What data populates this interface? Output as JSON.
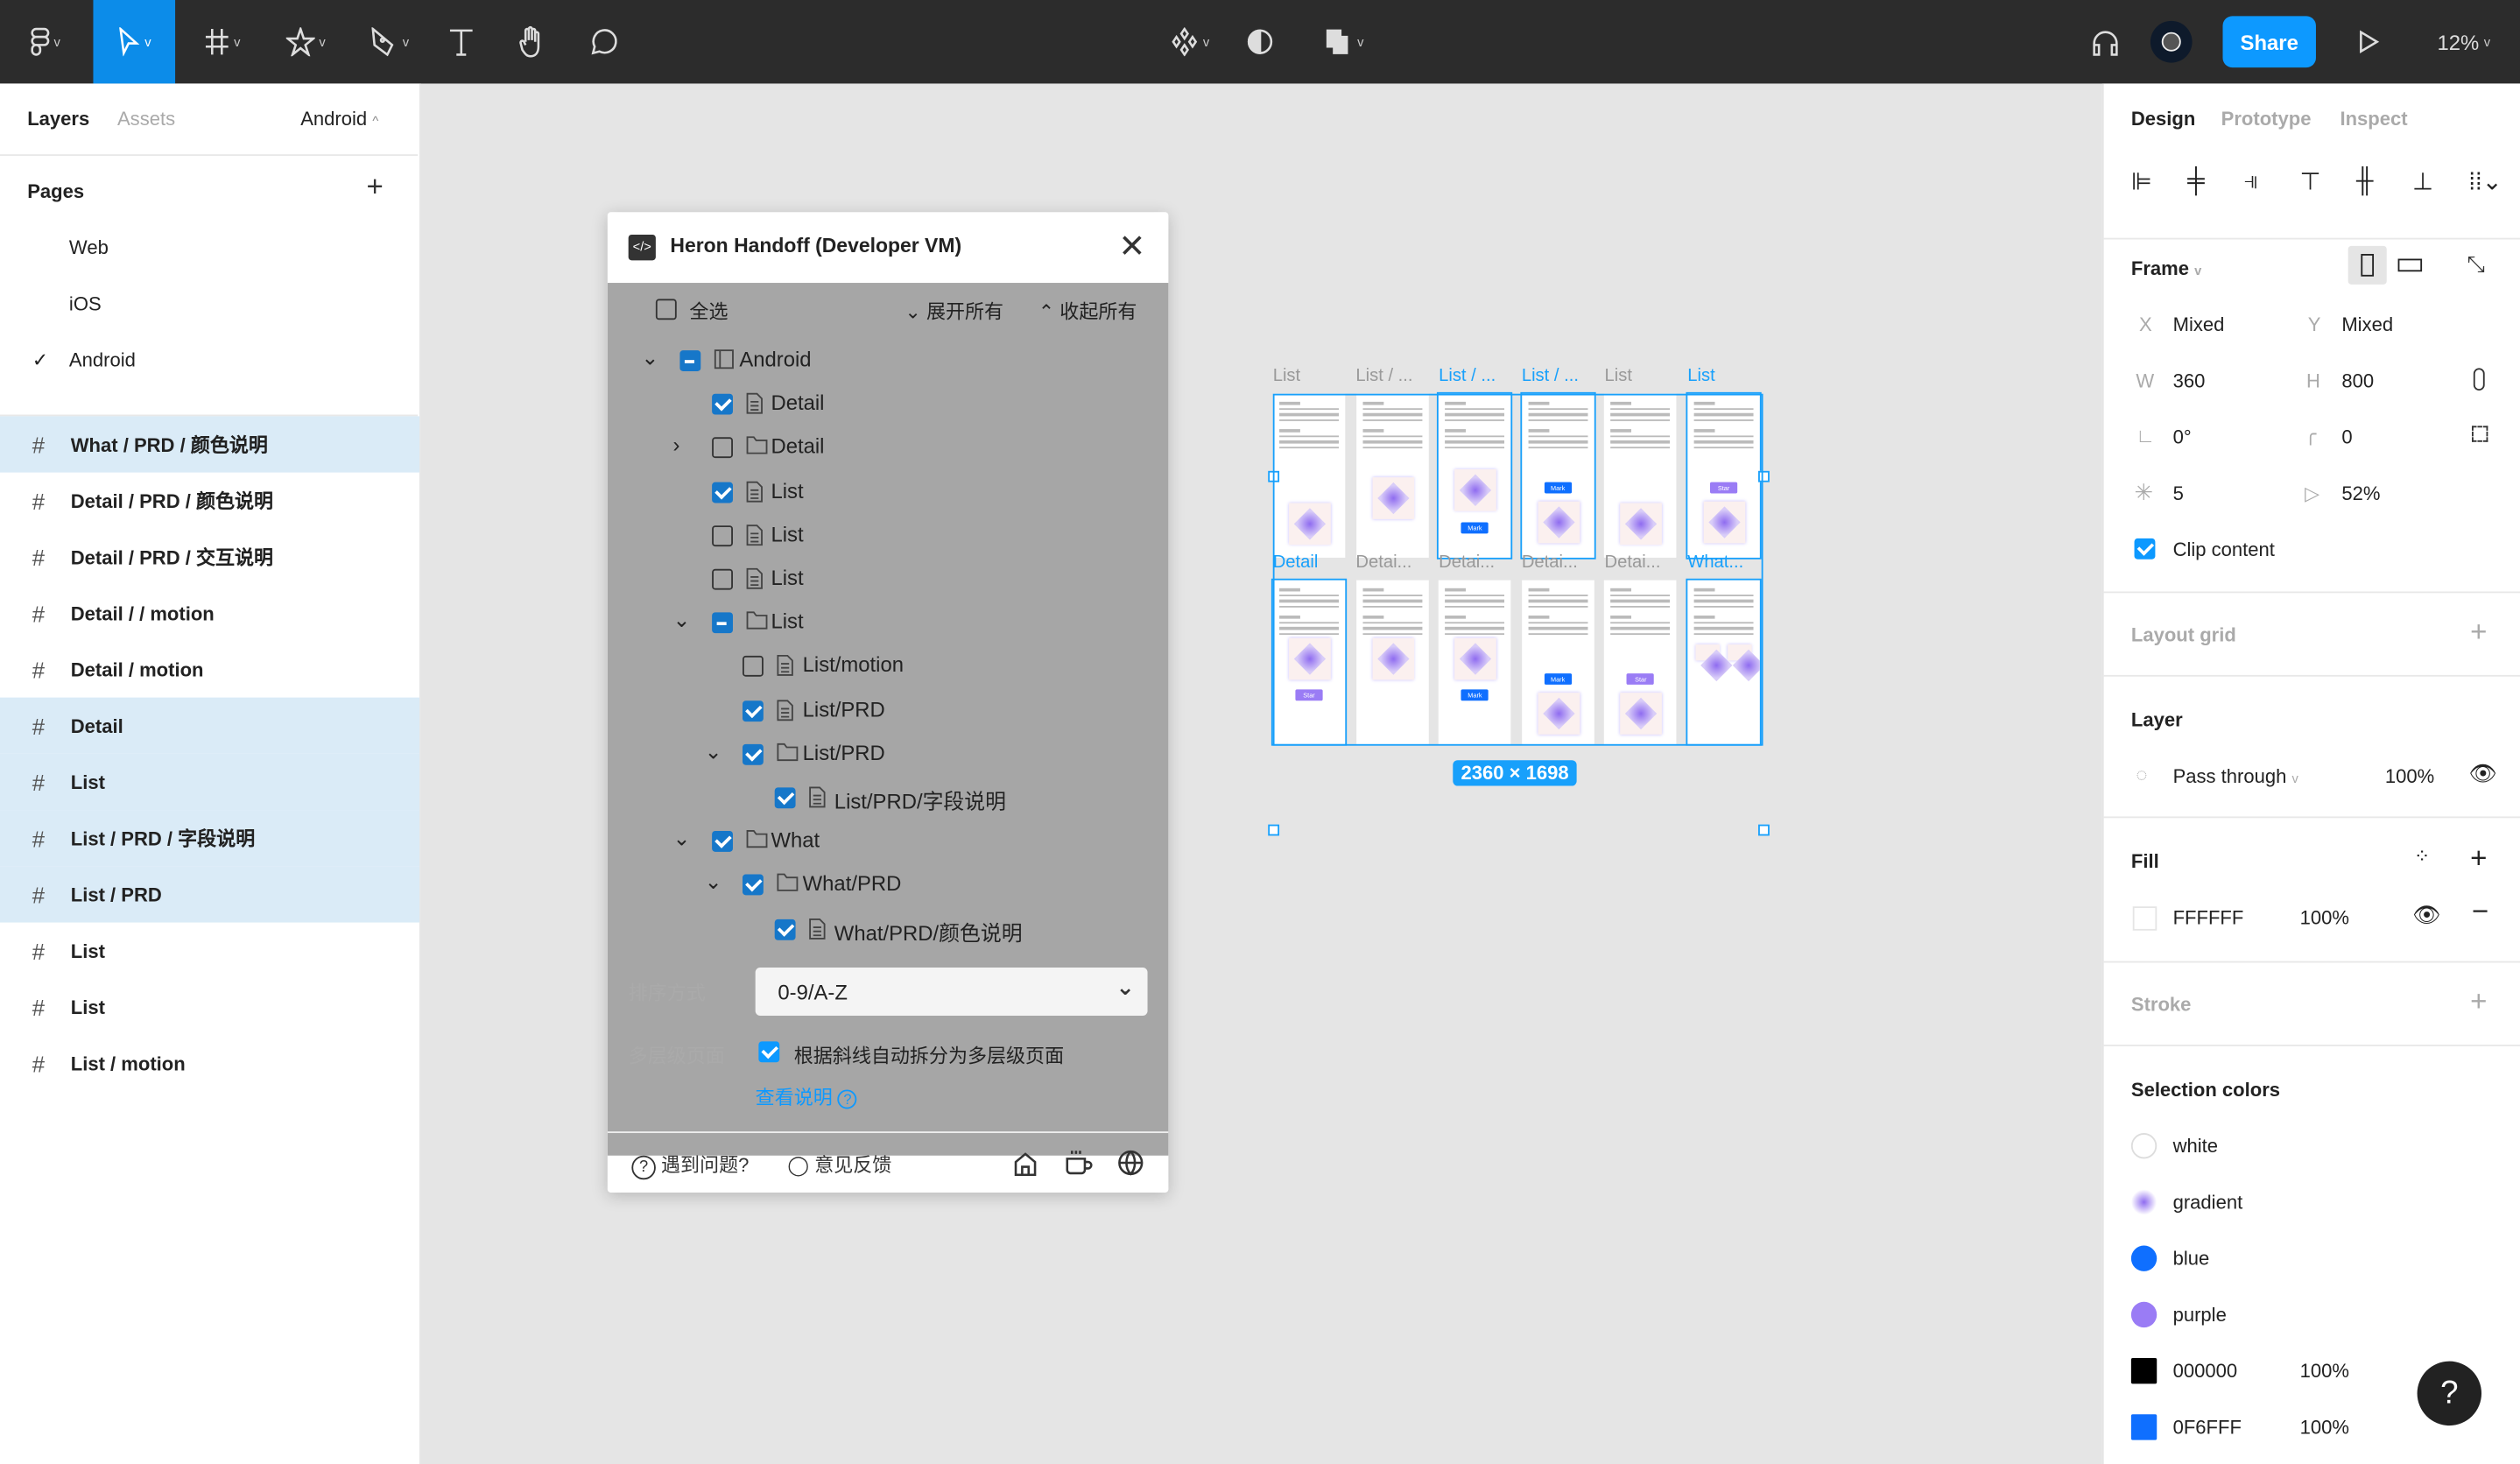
{
  "toolbar": {
    "tools": [
      "figma-menu",
      "move",
      "frame",
      "shape",
      "pen",
      "text",
      "hand",
      "comment"
    ],
    "share_label": "Share",
    "zoom": "12%",
    "accent": "#0d99ff"
  },
  "left_panel": {
    "tabs": [
      "Layers",
      "Assets"
    ],
    "page_selector": "Android",
    "pages_title": "Pages",
    "pages": [
      {
        "label": "Web",
        "current": false
      },
      {
        "label": "iOS",
        "current": false
      },
      {
        "label": "Android",
        "current": true
      }
    ],
    "layers": [
      {
        "label": "What / PRD / 颜色说明",
        "selected": true
      },
      {
        "label": "Detail / PRD / 颜色说明",
        "selected": false
      },
      {
        "label": "Detail / PRD / 交互说明",
        "selected": false
      },
      {
        "label": "Detail / / motion",
        "selected": false
      },
      {
        "label": "Detail / motion",
        "selected": false
      },
      {
        "label": "Detail",
        "selected": true
      },
      {
        "label": "List",
        "selected": true
      },
      {
        "label": "List / PRD / 字段说明",
        "selected": true
      },
      {
        "label": "List / PRD",
        "selected": true
      },
      {
        "label": "List",
        "selected": false
      },
      {
        "label": "List",
        "selected": false
      },
      {
        "label": "List / motion",
        "selected": false
      }
    ]
  },
  "plugin": {
    "title": "Heron Handoff (Developer VM)",
    "select_all": "全选",
    "expand_all": "展开所有",
    "collapse_all": "收起所有",
    "tree": [
      {
        "label": "Android",
        "level": 0,
        "chevron": "down",
        "check": "part",
        "icon": "frame"
      },
      {
        "label": "Detail",
        "level": 1,
        "chevron": "",
        "check": "on",
        "icon": "page"
      },
      {
        "label": "Detail",
        "level": 1,
        "chevron": "right",
        "check": "off",
        "icon": "folder"
      },
      {
        "label": "List",
        "level": 1,
        "chevron": "",
        "check": "on",
        "icon": "page"
      },
      {
        "label": "List",
        "level": 1,
        "chevron": "",
        "check": "off",
        "icon": "page"
      },
      {
        "label": "List",
        "level": 1,
        "chevron": "",
        "check": "off",
        "icon": "page"
      },
      {
        "label": "List",
        "level": 1,
        "chevron": "down",
        "check": "part",
        "icon": "folder"
      },
      {
        "label": "List/motion",
        "level": 2,
        "chevron": "",
        "check": "off",
        "icon": "page"
      },
      {
        "label": "List/PRD",
        "level": 2,
        "chevron": "",
        "check": "on",
        "icon": "page"
      },
      {
        "label": "List/PRD",
        "level": 2,
        "chevron": "down",
        "check": "on",
        "icon": "folder"
      },
      {
        "label": "List/PRD/字段说明",
        "level": 3,
        "chevron": "",
        "check": "on",
        "icon": "page"
      },
      {
        "label": "What",
        "level": 1,
        "chevron": "down",
        "check": "on",
        "icon": "folder"
      },
      {
        "label": "What/PRD",
        "level": 2,
        "chevron": "down",
        "check": "on",
        "icon": "folder"
      },
      {
        "label": "What/PRD/颜色说明",
        "level": 3,
        "chevron": "",
        "check": "on",
        "icon": "page"
      }
    ],
    "sort_label": "排序方式",
    "sort_value": "0-9/A-Z",
    "multilevel_label": "多层级页面",
    "multilevel_checked": true,
    "multilevel_text": "根据斜线自动拆分为多层级页面",
    "help_link": "查看说明",
    "problem": "遇到问题?",
    "feedback": "意见反馈"
  },
  "canvas": {
    "size_badge": "2360 × 1698",
    "frames": [
      {
        "label": "List",
        "selected": false,
        "badge": "",
        "badge_pos": ""
      },
      {
        "label": "List / ...",
        "selected": false,
        "badge": "",
        "badge_pos": ""
      },
      {
        "label": "List / ...",
        "selected": true,
        "badge": "Mark",
        "badge_pos": "below"
      },
      {
        "label": "List / ...",
        "selected": true,
        "badge": "Mark",
        "badge_pos": "above"
      },
      {
        "label": "List",
        "selected": false,
        "badge": "",
        "badge_pos": ""
      },
      {
        "label": "List",
        "selected": true,
        "badge": "Star",
        "badge_pos": "above"
      },
      {
        "label": "Detail",
        "selected": true,
        "badge": "Star",
        "badge_pos": "below"
      },
      {
        "label": "Detai...",
        "selected": false,
        "badge": "",
        "badge_pos": ""
      },
      {
        "label": "Detai...",
        "selected": false,
        "badge": "Mark",
        "badge_pos": "below"
      },
      {
        "label": "Detai...",
        "selected": false,
        "badge": "Mark",
        "badge_pos": "above"
      },
      {
        "label": "Detai...",
        "selected": false,
        "badge": "Star",
        "badge_pos": "above"
      },
      {
        "label": "What...",
        "selected": true,
        "badge": "",
        "badge_pos": "pair"
      }
    ]
  },
  "right_panel": {
    "tabs": [
      "Design",
      "Prototype",
      "Inspect"
    ],
    "frame_title": "Frame",
    "x_label": "X",
    "x": "Mixed",
    "y_label": "Y",
    "y": "Mixed",
    "w_label": "W",
    "w": "360",
    "h_label": "H",
    "h": "800",
    "rotation": "0°",
    "radius": "0",
    "count": "5",
    "ratio": "52%",
    "clip_label": "Clip content",
    "clip": true,
    "layout_grid": "Layout grid",
    "layer_title": "Layer",
    "blend": "Pass through",
    "opacity": "100%",
    "fill_title": "Fill",
    "fill_hex": "FFFFFF",
    "fill_opacity": "100%",
    "stroke_title": "Stroke",
    "selection_colors_title": "Selection colors",
    "selection_colors": [
      {
        "label": "white",
        "color": "#ffffff",
        "opacity": ""
      },
      {
        "label": "gradient",
        "color": "#9b7cf2",
        "opacity": ""
      },
      {
        "label": "blue",
        "color": "#0f6fff",
        "opacity": ""
      },
      {
        "label": "purple",
        "color": "#9a7cf5",
        "opacity": ""
      },
      {
        "label": "000000",
        "color": "#000000",
        "opacity": "100%"
      },
      {
        "label": "0F6FFF",
        "color": "#0f6fff",
        "opacity": "100%"
      }
    ],
    "help": "?"
  }
}
